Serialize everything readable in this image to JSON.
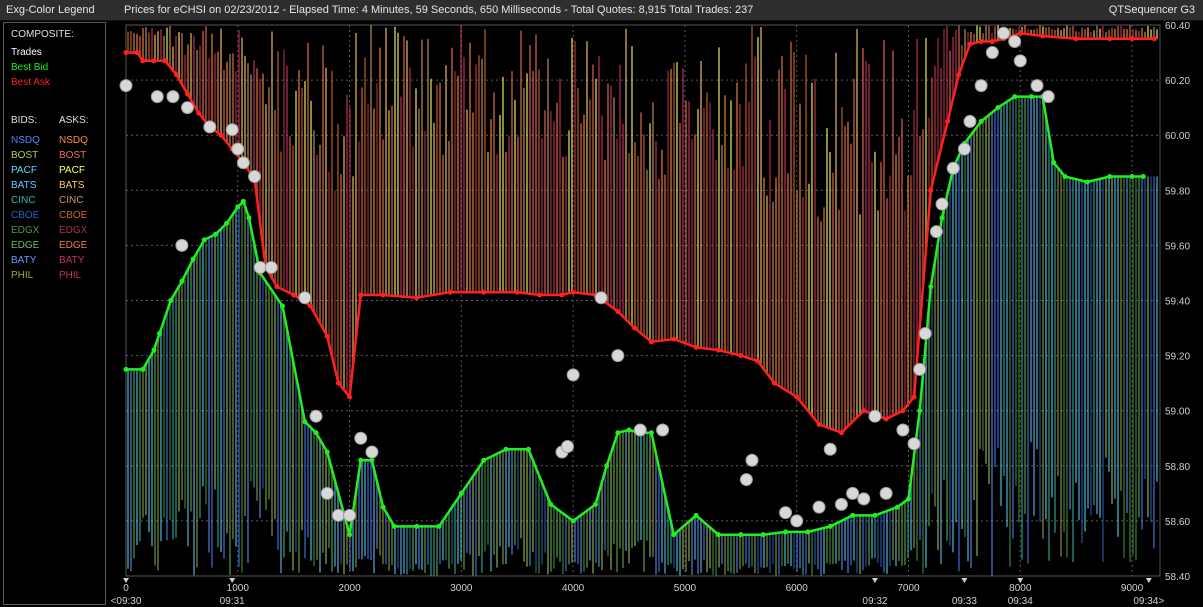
{
  "window": {
    "legend_title": "Exg-Color Legend",
    "header": "Prices for  eCHSI  on  02/23/2012  -  Elapsed Time: 4 Minutes, 59 Seconds, 650 Milliseconds  -  Total Quotes: 8,915  Total Trades: 237",
    "app_name": "QTSequencer G3"
  },
  "legend": {
    "composite_title": "COMPOSITE:",
    "composite": [
      {
        "label": "Trades",
        "color": "#ffffff"
      },
      {
        "label": "Best Bid",
        "color": "#22ee22"
      },
      {
        "label": "Best Ask",
        "color": "#ff2020"
      }
    ],
    "bids_title": "BIDS:",
    "asks_title": "ASKS:",
    "exchanges": [
      {
        "bid": "NSDQ",
        "ask": "NSDQ",
        "bid_color": "#4a86ff",
        "ask_color": "#ff8c3a"
      },
      {
        "bid": "BOST",
        "ask": "BOST",
        "bid_color": "#aacc66",
        "ask_color": "#ee6e5a"
      },
      {
        "bid": "PACF",
        "ask": "PACF",
        "bid_color": "#5ae0ff",
        "ask_color": "#ffff66"
      },
      {
        "bid": "BATS",
        "ask": "BATS",
        "bid_color": "#66ccff",
        "ask_color": "#ffcc66"
      },
      {
        "bid": "CINC",
        "ask": "CINC",
        "bid_color": "#33bbaa",
        "ask_color": "#cc9966"
      },
      {
        "bid": "CBOE",
        "ask": "CBOE",
        "bid_color": "#2266bb",
        "ask_color": "#cc6622"
      },
      {
        "bid": "EDGX",
        "ask": "EDGX",
        "bid_color": "#449944",
        "ask_color": "#aa3344"
      },
      {
        "bid": "EDGE",
        "ask": "EDGE",
        "bid_color": "#66bb55",
        "ask_color": "#ee7744"
      },
      {
        "bid": "BATY",
        "ask": "BATY",
        "bid_color": "#6699ff",
        "ask_color": "#cc3355"
      },
      {
        "bid": "PHIL",
        "ask": "PHIL",
        "bid_color": "#99aa44",
        "ask_color": "#cc3366"
      }
    ]
  },
  "chart_data": {
    "type": "line",
    "x_range": [
      0,
      9250
    ],
    "ylim": [
      58.4,
      60.4
    ],
    "y_ticks": [
      "60.40",
      "60.20",
      "60.00",
      "59.80",
      "59.60",
      "59.40",
      "59.20",
      "59.00",
      "58.80",
      "58.60",
      "58.40"
    ],
    "x_ticks": [
      "0",
      "1000",
      "2000",
      "3000",
      "4000",
      "5000",
      "6000",
      "7000",
      "8000",
      "9000"
    ],
    "time_markers": [
      {
        "x": 0,
        "label": "<09:30"
      },
      {
        "x": 950,
        "label": "09:31"
      },
      {
        "x": 6700,
        "label": "09:32"
      },
      {
        "x": 7500,
        "label": "09:33"
      },
      {
        "x": 8000,
        "label": "09:34"
      },
      {
        "x": 9150,
        "label": "09:34>"
      }
    ],
    "series": [
      {
        "name": "Best Ask",
        "color": "#ff2020",
        "points": [
          [
            0,
            60.3
          ],
          [
            100,
            60.3
          ],
          [
            150,
            60.27
          ],
          [
            250,
            60.27
          ],
          [
            350,
            60.27
          ],
          [
            450,
            60.22
          ],
          [
            550,
            60.15
          ],
          [
            650,
            60.08
          ],
          [
            750,
            60.03
          ],
          [
            850,
            60.0
          ],
          [
            950,
            59.95
          ],
          [
            1050,
            59.9
          ],
          [
            1150,
            59.84
          ],
          [
            1250,
            59.52
          ],
          [
            1350,
            59.45
          ],
          [
            1500,
            59.42
          ],
          [
            1650,
            59.38
          ],
          [
            1800,
            59.27
          ],
          [
            1900,
            59.1
          ],
          [
            2000,
            59.05
          ],
          [
            2100,
            59.42
          ],
          [
            2300,
            59.42
          ],
          [
            2600,
            59.41
          ],
          [
            2900,
            59.43
          ],
          [
            3200,
            59.43
          ],
          [
            3500,
            59.43
          ],
          [
            3700,
            59.42
          ],
          [
            3900,
            59.42
          ],
          [
            4000,
            59.43
          ],
          [
            4200,
            59.42
          ],
          [
            4400,
            59.36
          ],
          [
            4550,
            59.3
          ],
          [
            4700,
            59.25
          ],
          [
            4900,
            59.26
          ],
          [
            5100,
            59.23
          ],
          [
            5300,
            59.22
          ],
          [
            5500,
            59.2
          ],
          [
            5650,
            59.18
          ],
          [
            5800,
            59.1
          ],
          [
            6000,
            59.05
          ],
          [
            6200,
            58.95
          ],
          [
            6400,
            58.92
          ],
          [
            6600,
            59.0
          ],
          [
            6800,
            58.97
          ],
          [
            6950,
            59.0
          ],
          [
            7050,
            59.05
          ],
          [
            7200,
            59.8
          ],
          [
            7350,
            60.05
          ],
          [
            7450,
            60.22
          ],
          [
            7550,
            60.33
          ],
          [
            7650,
            60.34
          ],
          [
            7750,
            60.34
          ],
          [
            7850,
            60.35
          ],
          [
            8000,
            60.37
          ],
          [
            8200,
            60.36
          ],
          [
            8500,
            60.35
          ],
          [
            8800,
            60.35
          ],
          [
            9000,
            60.35
          ],
          [
            9200,
            60.35
          ]
        ]
      },
      {
        "name": "Best Bid",
        "color": "#22ee22",
        "points": [
          [
            0,
            59.15
          ],
          [
            150,
            59.15
          ],
          [
            250,
            59.22
          ],
          [
            300,
            59.28
          ],
          [
            400,
            59.4
          ],
          [
            500,
            59.47
          ],
          [
            600,
            59.55
          ],
          [
            700,
            59.62
          ],
          [
            800,
            59.64
          ],
          [
            900,
            59.68
          ],
          [
            1000,
            59.74
          ],
          [
            1050,
            59.76
          ],
          [
            1100,
            59.7
          ],
          [
            1200,
            59.5
          ],
          [
            1400,
            59.38
          ],
          [
            1600,
            58.96
          ],
          [
            1700,
            58.92
          ],
          [
            1800,
            58.85
          ],
          [
            2000,
            58.55
          ],
          [
            2100,
            58.82
          ],
          [
            2200,
            58.82
          ],
          [
            2300,
            58.65
          ],
          [
            2400,
            58.58
          ],
          [
            2600,
            58.58
          ],
          [
            2800,
            58.58
          ],
          [
            3000,
            58.7
          ],
          [
            3200,
            58.82
          ],
          [
            3400,
            58.86
          ],
          [
            3600,
            58.86
          ],
          [
            3800,
            58.66
          ],
          [
            4000,
            58.6
          ],
          [
            4200,
            58.66
          ],
          [
            4300,
            58.8
          ],
          [
            4400,
            58.92
          ],
          [
            4500,
            58.93
          ],
          [
            4600,
            58.92
          ],
          [
            4700,
            58.92
          ],
          [
            4900,
            58.55
          ],
          [
            5100,
            58.62
          ],
          [
            5300,
            58.55
          ],
          [
            5500,
            58.55
          ],
          [
            5700,
            58.55
          ],
          [
            5900,
            58.56
          ],
          [
            6100,
            58.56
          ],
          [
            6300,
            58.58
          ],
          [
            6500,
            58.62
          ],
          [
            6700,
            58.62
          ],
          [
            6900,
            58.65
          ],
          [
            7000,
            58.68
          ],
          [
            7100,
            59.0
          ],
          [
            7200,
            59.45
          ],
          [
            7300,
            59.7
          ],
          [
            7400,
            59.88
          ],
          [
            7500,
            59.97
          ],
          [
            7650,
            60.05
          ],
          [
            7800,
            60.1
          ],
          [
            7950,
            60.14
          ],
          [
            8100,
            60.14
          ],
          [
            8200,
            60.14
          ],
          [
            8300,
            59.9
          ],
          [
            8400,
            59.85
          ],
          [
            8600,
            59.83
          ],
          [
            8800,
            59.85
          ],
          [
            9000,
            59.85
          ],
          [
            9100,
            59.85
          ]
        ]
      },
      {
        "name": "Trades",
        "color": "#d8d8d8",
        "points": [
          [
            0,
            60.18
          ],
          [
            280,
            60.14
          ],
          [
            420,
            60.14
          ],
          [
            550,
            60.1
          ],
          [
            750,
            60.03
          ],
          [
            950,
            60.02
          ],
          [
            1000,
            59.95
          ],
          [
            1050,
            59.9
          ],
          [
            1150,
            59.85
          ],
          [
            1200,
            59.52
          ],
          [
            1300,
            59.52
          ],
          [
            500,
            59.6
          ],
          [
            1600,
            59.41
          ],
          [
            1700,
            58.98
          ],
          [
            1800,
            58.7
          ],
          [
            1900,
            58.62
          ],
          [
            2000,
            58.62
          ],
          [
            2100,
            58.9
          ],
          [
            2200,
            58.85
          ],
          [
            3900,
            58.85
          ],
          [
            3950,
            58.87
          ],
          [
            4000,
            59.13
          ],
          [
            4250,
            59.41
          ],
          [
            4400,
            59.2
          ],
          [
            4600,
            58.93
          ],
          [
            4800,
            58.93
          ],
          [
            5550,
            58.75
          ],
          [
            5600,
            58.82
          ],
          [
            5900,
            58.63
          ],
          [
            6000,
            58.6
          ],
          [
            6200,
            58.65
          ],
          [
            6300,
            58.86
          ],
          [
            6400,
            58.66
          ],
          [
            6500,
            58.7
          ],
          [
            6600,
            58.68
          ],
          [
            6700,
            58.98
          ],
          [
            6800,
            58.7
          ],
          [
            6950,
            58.93
          ],
          [
            7050,
            58.88
          ],
          [
            7100,
            59.15
          ],
          [
            7150,
            59.28
          ],
          [
            7250,
            59.65
          ],
          [
            7300,
            59.75
          ],
          [
            7400,
            59.88
          ],
          [
            7500,
            59.95
          ],
          [
            7550,
            60.05
          ],
          [
            7650,
            60.18
          ],
          [
            7750,
            60.3
          ],
          [
            7850,
            60.37
          ],
          [
            7950,
            60.34
          ],
          [
            8000,
            60.27
          ],
          [
            8150,
            60.18
          ],
          [
            8250,
            60.14
          ]
        ]
      }
    ]
  }
}
